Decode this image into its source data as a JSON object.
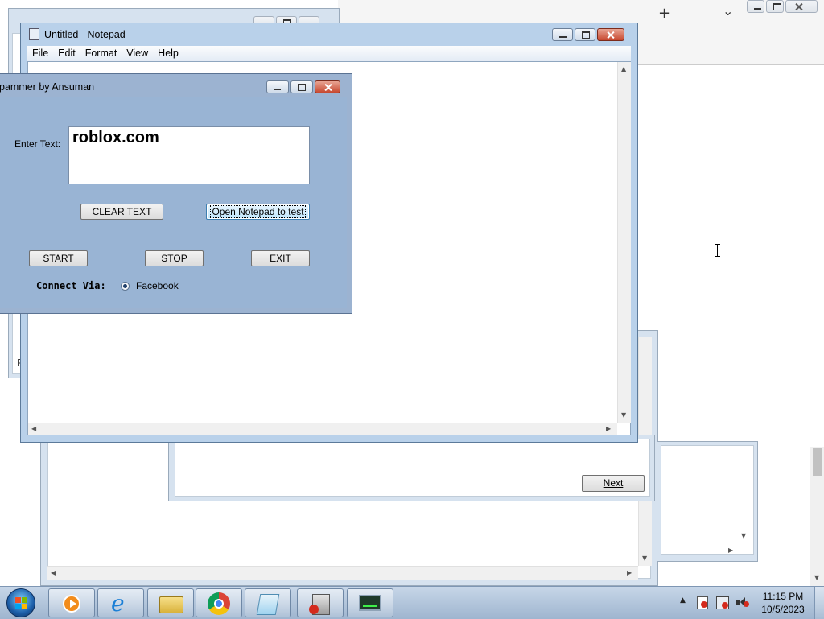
{
  "browser": {
    "new_tab_glyph": "+",
    "tab_list_glyph": "⌄"
  },
  "notepad": {
    "title": "Untitled - Notepad",
    "menus": [
      "File",
      "Edit",
      "Format",
      "View",
      "Help"
    ]
  },
  "background_window": {
    "title_fragment": "R"
  },
  "wizard": {
    "next_label": "Next"
  },
  "spammer": {
    "title": "pammer by Ansuman",
    "enter_text_label": "Enter Text:",
    "text_value": "roblox.com",
    "clear_label": "CLEAR TEXT",
    "open_notepad_label": "Open Notepad to test",
    "start_label": "START",
    "stop_label": "STOP",
    "exit_label": "EXIT",
    "connect_via_label": "Connect Via:",
    "radio_facebook_label": "Facebook",
    "radio_selected": "Facebook"
  },
  "taskbar": {
    "apps": [
      {
        "name": "media-player-icon"
      },
      {
        "name": "internet-explorer-icon"
      },
      {
        "name": "file-explorer-icon"
      },
      {
        "name": "chrome-icon"
      },
      {
        "name": "notepad-app-icon"
      },
      {
        "name": "spammer-app-icon"
      },
      {
        "name": "task-manager-icon"
      }
    ],
    "clock_time": "11:15 PM",
    "clock_date": "10/5/2023"
  },
  "colors": {
    "accent": "#99b4d4",
    "close_red": "#c7482f"
  }
}
